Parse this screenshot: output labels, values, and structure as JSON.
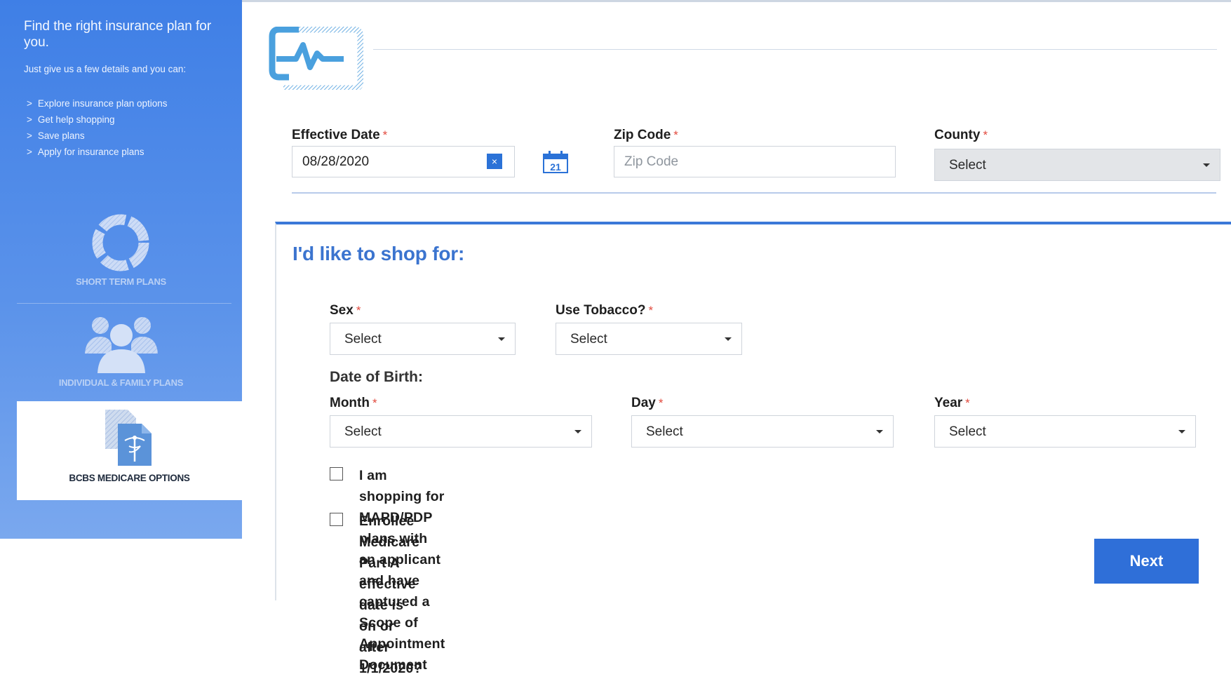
{
  "sidebar": {
    "title": "Find the right insurance plan for you.",
    "intro": "Just give us a few details and you can:",
    "list_marker": ">",
    "items": [
      "Explore insurance plan options",
      "Get help shopping",
      "Save plans",
      "Apply for insurance plans"
    ],
    "plans": {
      "short_term": "SHORT TERM PLANS",
      "individual_family": "INDIVIDUAL & FAMILY PLANS",
      "bcbs_medicare": "BCBS MEDICARE OPTIONS"
    }
  },
  "form": {
    "effective_date": {
      "label": "Effective Date",
      "value": "08/28/2020",
      "clear": "×",
      "calendar_day": "21"
    },
    "zip_code": {
      "label": "Zip Code",
      "placeholder": "Zip Code",
      "value": ""
    },
    "county": {
      "label": "County",
      "value": "Select"
    },
    "required_marker": "*"
  },
  "shop": {
    "title": "I'd like to shop for:",
    "sex": {
      "label": "Sex",
      "value": "Select"
    },
    "tobacco": {
      "label": "Use Tobacco?",
      "value": "Select"
    },
    "dob_heading": "Date of Birth:",
    "month": {
      "label": "Month",
      "value": "Select"
    },
    "day": {
      "label": "Day",
      "value": "Select"
    },
    "year": {
      "label": "Year",
      "value": "Select"
    },
    "checkbox_scope_line1": "I am shopping for MAPD/PDP plans with an applicant and have captured a Scope of",
    "checkbox_scope_line2": "Appointment Document",
    "checkbox_medicare": "Enrollee Medicare Part A effective date is on or after 1/1/2020?",
    "next_label": "Next"
  },
  "colors": {
    "sidebar_top": "#3f7fe6",
    "accent": "#2f6fd8",
    "required": "#e24b3f",
    "heading": "#3b74cf"
  },
  "icons": [
    "heartbeat-logo-icon",
    "calendar-icon",
    "ring-icon",
    "people-icon",
    "medical-document-icon",
    "chevron-down-icon"
  ]
}
